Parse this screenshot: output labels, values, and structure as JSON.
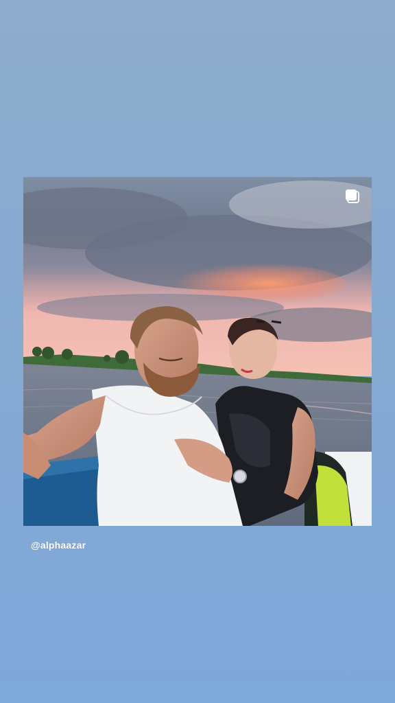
{
  "story": {
    "shared_post": {
      "multi_photo_icon": "carousel-icon",
      "photo_subject": "couple-on-boat-at-sunset"
    },
    "attribution": {
      "handle": "@alphaazar"
    }
  },
  "colors": {
    "background_top": "#8eadcc",
    "background_bottom": "#7ea7da",
    "handle_text": "#ffffff"
  }
}
